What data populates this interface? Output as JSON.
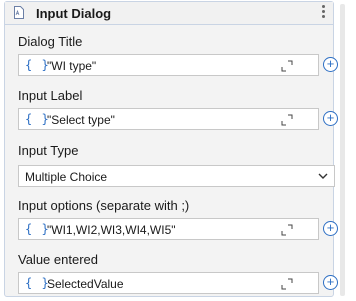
{
  "activity": {
    "title": "Input Dialog",
    "icon": "document-icon",
    "menu_icon": "kebab-menu-icon"
  },
  "fields": {
    "dialog_title": {
      "label": "Dialog Title",
      "value": "\"WI type\""
    },
    "input_label": {
      "label": "Input Label",
      "value": "\"Select type\""
    },
    "input_type": {
      "label": "Input Type",
      "value": "Multiple Choice"
    },
    "input_options": {
      "label": "Input options (separate with ;)",
      "value": "\"WI1,WI2,WI3,WI4,WI5\""
    },
    "value_entered": {
      "label": "Value entered",
      "value": "SelectedValue"
    }
  },
  "expression_marker": "{ }",
  "plus_symbol": "+",
  "colors": {
    "accent": "#2d6fc4",
    "border": "#c9d4e4",
    "panel_bg": "#f3f3f3"
  }
}
